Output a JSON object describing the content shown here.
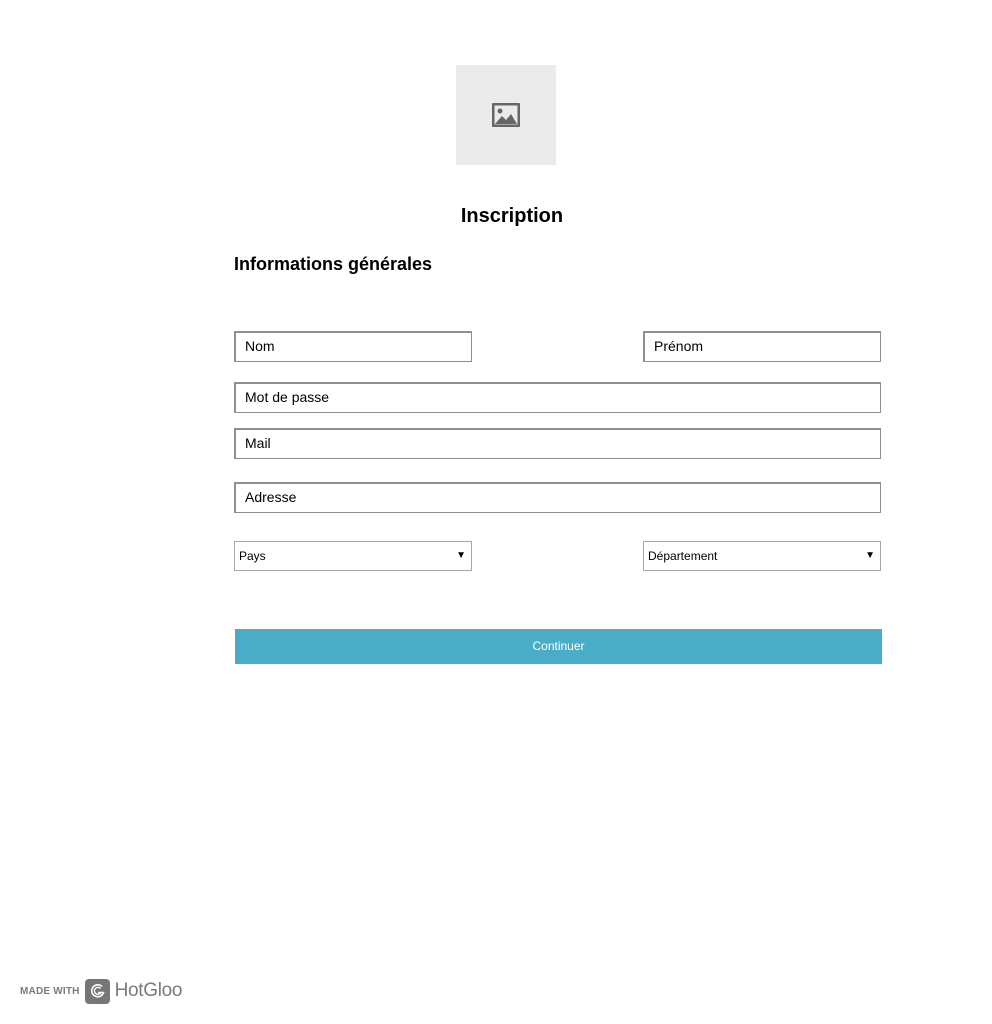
{
  "header": {
    "logo_icon": "image-placeholder-icon",
    "title": "Inscription"
  },
  "form": {
    "section_title": "Informations générales",
    "fields": {
      "nom": "Nom",
      "prenom": "Prénom",
      "mot_de_passe": "Mot de passe",
      "mail": "Mail",
      "adresse": "Adresse"
    },
    "selects": {
      "pays": "Pays",
      "departement": "Département",
      "arrow_icon": "triangle-down-icon"
    },
    "submit_label": "Continuer"
  },
  "footer": {
    "made_with": "MADE WITH",
    "brand_icon": "hotgloo-logo-icon",
    "brand": "HotGloo"
  },
  "colors": {
    "accent": "#4aacc6",
    "placeholder_bg": "#ebebeb",
    "field_border": "#8f8f8f"
  }
}
